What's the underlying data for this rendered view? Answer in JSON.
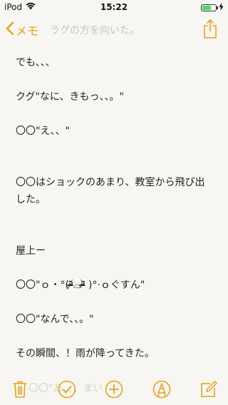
{
  "status_bar": {
    "carrier": "iPod",
    "time": "15:22"
  },
  "nav": {
    "back_label": "メモ",
    "faded_text": "ラグの方を向いた。"
  },
  "note": {
    "lines": [
      "でも、、、",
      "",
      "クグ\"なに、きもっ、、。\"",
      "",
      "〇〇\"え、、\"",
      "",
      "",
      "〇〇はショックのあまり、教室から飛び出した。",
      "",
      "",
      "屋上ー",
      "",
      "〇〇\"ｏ・°(ᵒ̴̶̷᷄⌓ᵒ̴̶̷᷅ )°·ｏぐすん\"",
      "",
      "〇〇\"なんで、、。\"",
      "",
      "その瞬間、！雨が降ってきた。"
    ]
  },
  "toolbar": {
    "faded_text": "〇〇\"あ、、、まい"
  },
  "colors": {
    "accent": "#e6a11b",
    "background": "#f7f6f2",
    "battery": "#4cd964"
  },
  "battery_level": 0.7,
  "icons": {
    "wifi": "wifi-icon",
    "back": "chevron-left-icon",
    "share": "share-icon",
    "trash": "trash-icon",
    "check": "checklist-icon",
    "add": "add-icon",
    "markup": "markup-icon",
    "compose": "compose-icon"
  }
}
